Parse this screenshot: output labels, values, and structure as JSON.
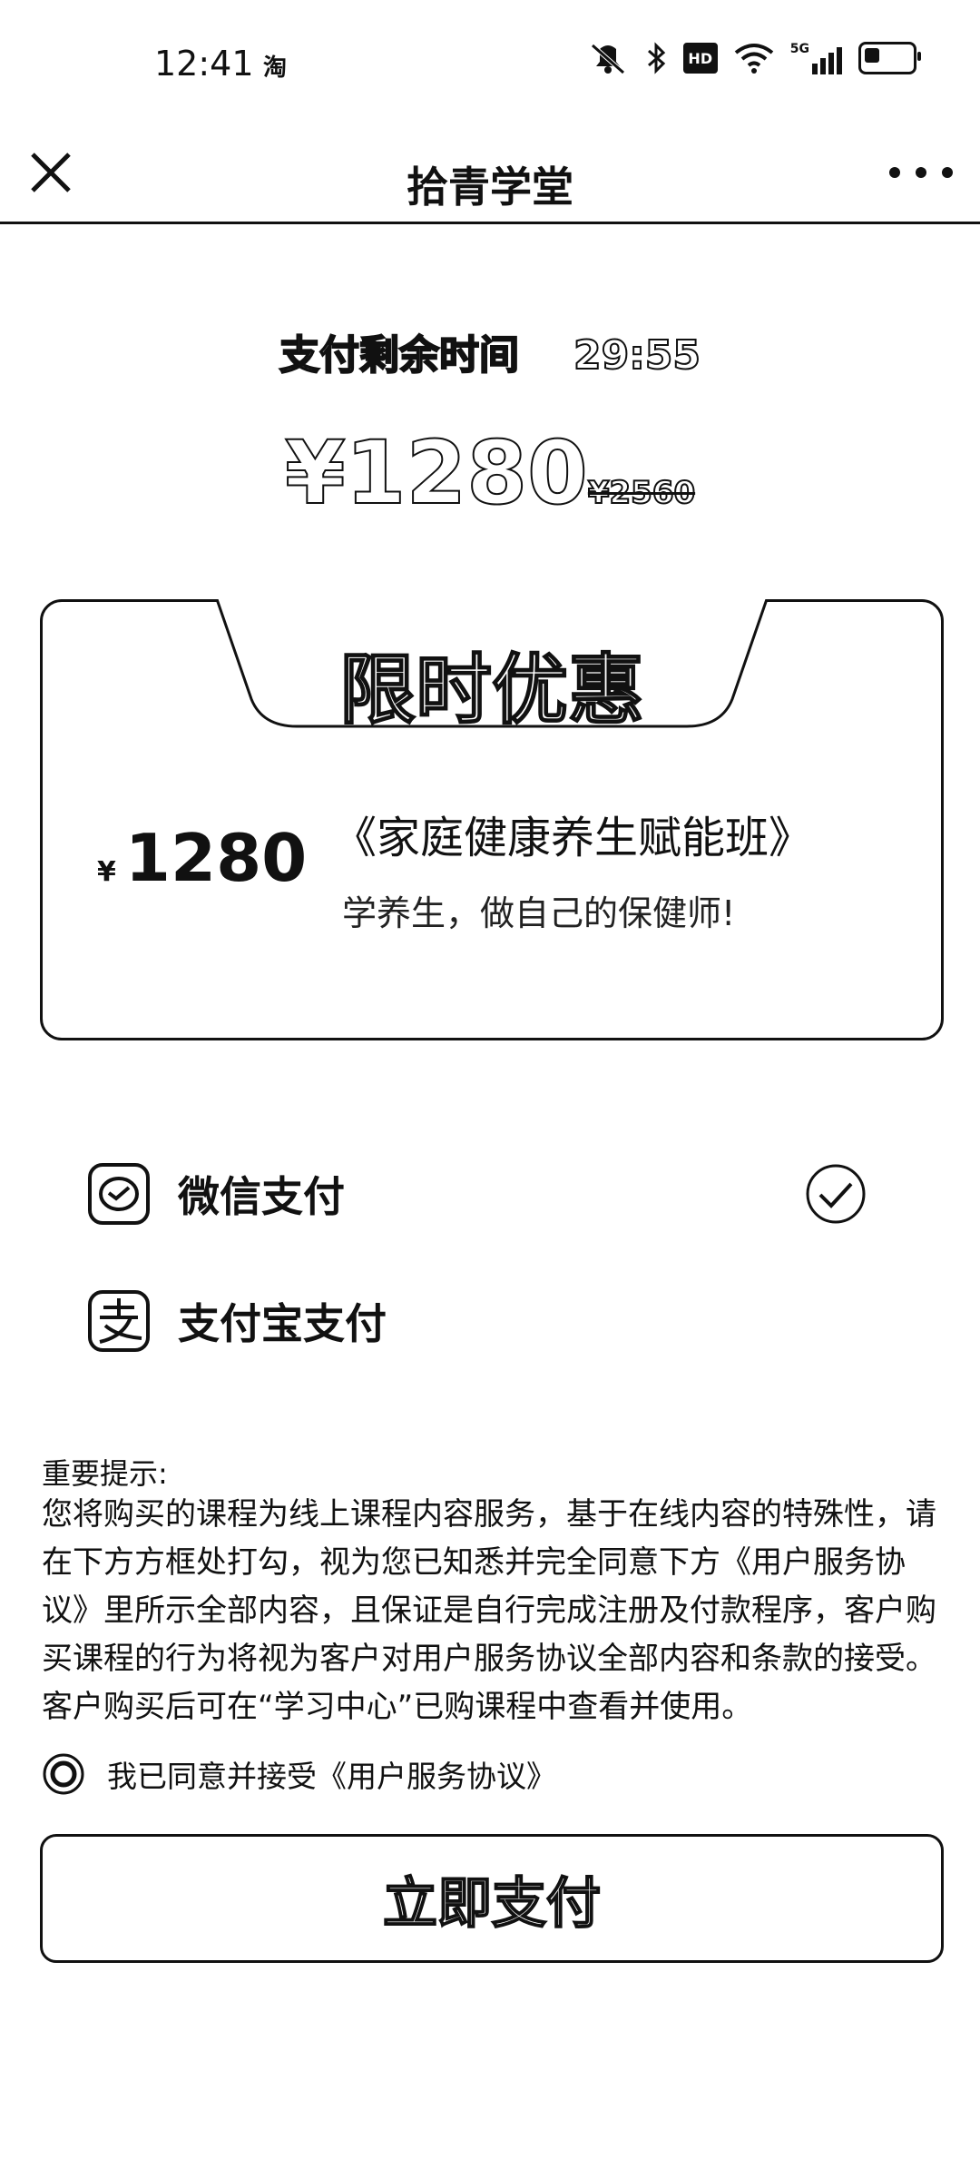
{
  "status_bar": {
    "time": "12:41",
    "app_badge": "淘",
    "icons": [
      "mute-icon",
      "bluetooth-icon",
      "hd-icon",
      "wifi-icon",
      "signal-5g-icon",
      "battery-icon"
    ],
    "hd_label": "HD",
    "network": "5G"
  },
  "nav": {
    "title": "拾青学堂",
    "close_icon": "close-icon",
    "more_icon": "more-icon"
  },
  "countdown": {
    "label": "支付剩余时间",
    "value": "29:55"
  },
  "price_header": {
    "current": "¥1280",
    "original": "¥2560"
  },
  "promo_card": {
    "tab_title": "限时优惠",
    "price_symbol": "¥",
    "price": "1280",
    "course_title": "《家庭健康养生赋能班》",
    "course_subtitle": "学养生，做自己的保健师!"
  },
  "payment_methods": [
    {
      "label": "微信支付",
      "icon": "wechat-pay-icon",
      "selected": true
    },
    {
      "label": "支付宝支付",
      "icon": "alipay-icon",
      "selected": false
    }
  ],
  "notice": {
    "label": "重要提示:",
    "text": "您将购买的课程为线上课程内容服务，基于在线内容的特殊性，请在下方方框处打勾，视为您已知悉并完全同意下方《用户服务协议》里所示全部内容，且保证是自行完成注册及付款程序，客户购买课程的行为将视为客户对用户服务协议全部内容和条款的接受。客户购买后可在“学习中心”已购课程中查看并使用。"
  },
  "agreement": {
    "text": "我已同意并接受《用户服务协议》",
    "checked": true
  },
  "pay_button": {
    "label": "立即支付"
  }
}
